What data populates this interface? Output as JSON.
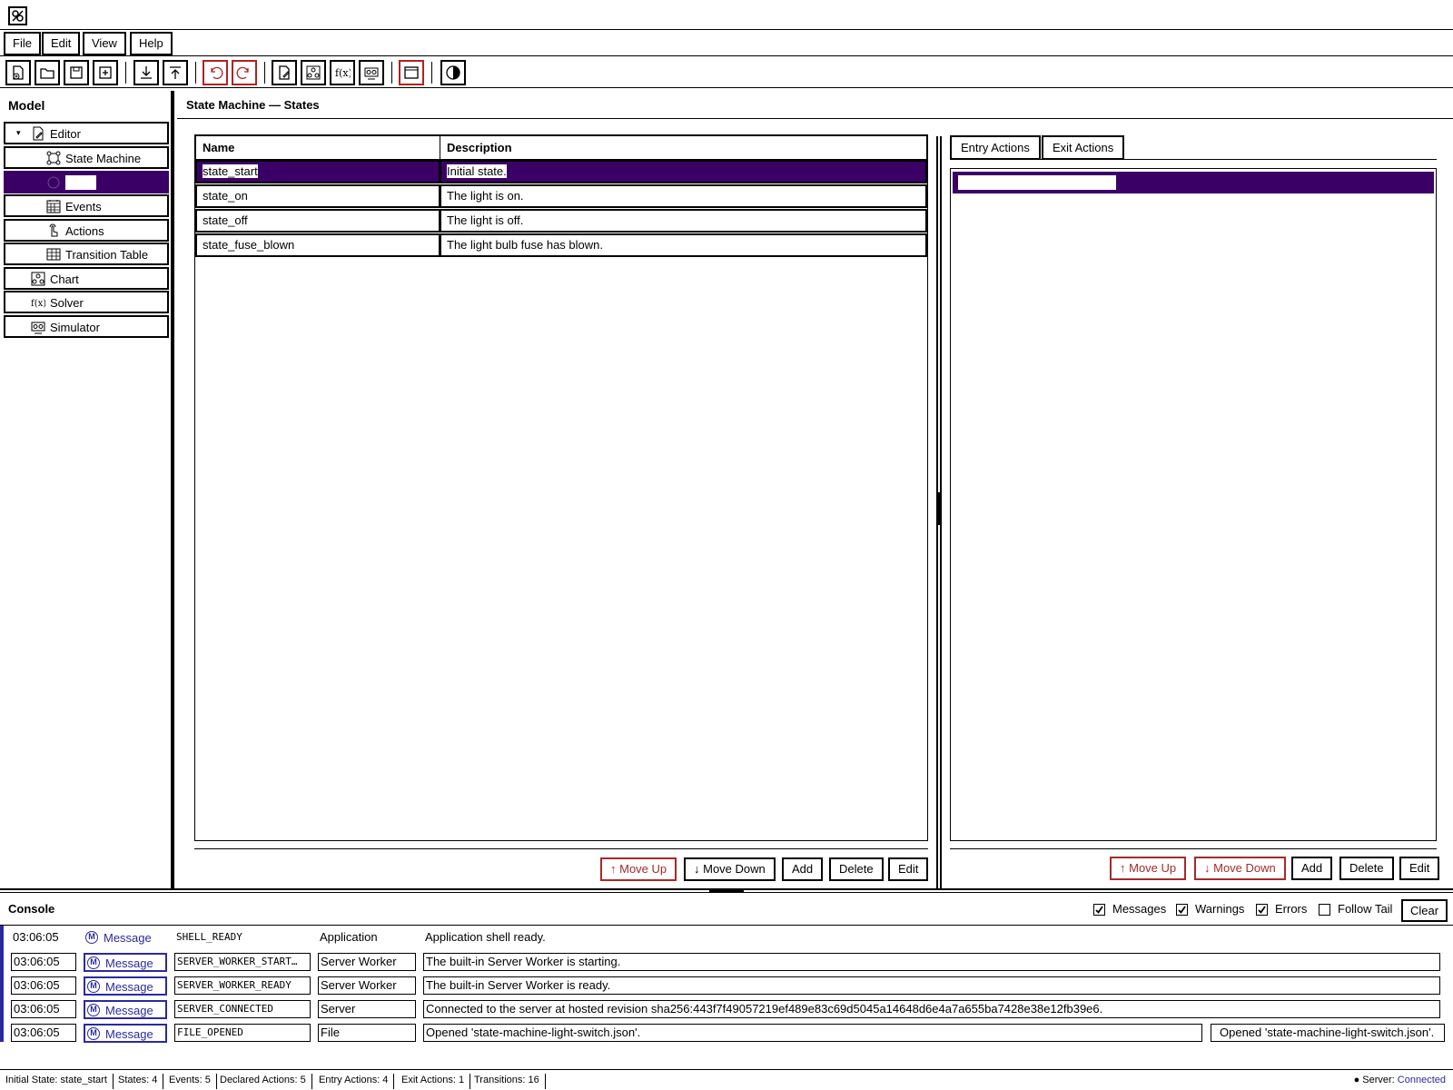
{
  "menu": [
    "File",
    "Edit",
    "View",
    "Help"
  ],
  "model": {
    "header": "Model",
    "items": [
      {
        "label": "Editor"
      },
      {
        "label": "State Machine"
      },
      {
        "label": ""
      },
      {
        "label": "Events"
      },
      {
        "label": "Actions"
      },
      {
        "label": "Transition Table"
      },
      {
        "label": "Chart"
      },
      {
        "label": "Solver"
      },
      {
        "label": "Simulator"
      }
    ]
  },
  "main": {
    "title": "State Machine — States",
    "columns": [
      "Name",
      "Description"
    ],
    "rows": [
      {
        "name": "state_start",
        "description": "Initial state."
      },
      {
        "name": "state_on",
        "description": "The light is on."
      },
      {
        "name": "state_off",
        "description": "The light is off."
      },
      {
        "name": "state_fuse_blown",
        "description": "The light bulb fuse has blown."
      }
    ],
    "buttons": {
      "move_up": "↑ Move Up",
      "move_down": "↓ Move Down",
      "add": "Add",
      "delete": "Delete",
      "edit": "Edit"
    }
  },
  "actions_panel": {
    "tabs": [
      "Entry Actions",
      "Exit Actions"
    ],
    "buttons": {
      "move_up": "↑ Move Up",
      "move_down": "↓ Move Down",
      "add": "Add",
      "delete": "Delete",
      "edit": "Edit"
    }
  },
  "console": {
    "title": "Console",
    "filters": [
      {
        "label": "Messages",
        "checked": true
      },
      {
        "label": "Warnings",
        "checked": true
      },
      {
        "label": "Errors",
        "checked": true
      },
      {
        "label": "Follow Tail",
        "checked": false
      }
    ],
    "clear_label": "Clear",
    "logs": [
      {
        "time": "03:06:05",
        "type": "Message",
        "code": "SHELL_READY",
        "source": "Application",
        "message": "Application shell ready.",
        "extra": ""
      },
      {
        "time": "03:06:05",
        "type": "Message",
        "code": "SERVER_WORKER_START…",
        "source": "Server Worker",
        "message": "The built-in Server Worker is starting.",
        "extra": ""
      },
      {
        "time": "03:06:05",
        "type": "Message",
        "code": "SERVER_WORKER_READY",
        "source": "Server Worker",
        "message": "The built-in Server Worker is ready.",
        "extra": ""
      },
      {
        "time": "03:06:05",
        "type": "Message",
        "code": "SERVER_CONNECTED",
        "source": "Server",
        "message": "Connected to the server at hosted revision sha256:443f7f49057219ef489e83c69d5045a14648d6e4a7a655ba7428e38e12fb39e6.",
        "extra": ""
      },
      {
        "time": "03:06:05",
        "type": "Message",
        "code": "FILE_OPENED",
        "source": "File",
        "message": "Opened 'state-machine-light-switch.json'.",
        "extra": "Opened 'state-machine-light-switch.json'."
      }
    ]
  },
  "status": {
    "items": [
      "Initial State: state_start",
      "States: 4",
      "Events: 5",
      "Declared Actions: 5",
      "Entry Actions: 4",
      "Exit Actions: 1",
      "Transitions: 16"
    ],
    "server_label": "● Server:",
    "server_state": "Connected"
  },
  "colors": {
    "selection": "#3b0066",
    "accent": "#2a2aa0",
    "disabled": "#a52a2a"
  }
}
